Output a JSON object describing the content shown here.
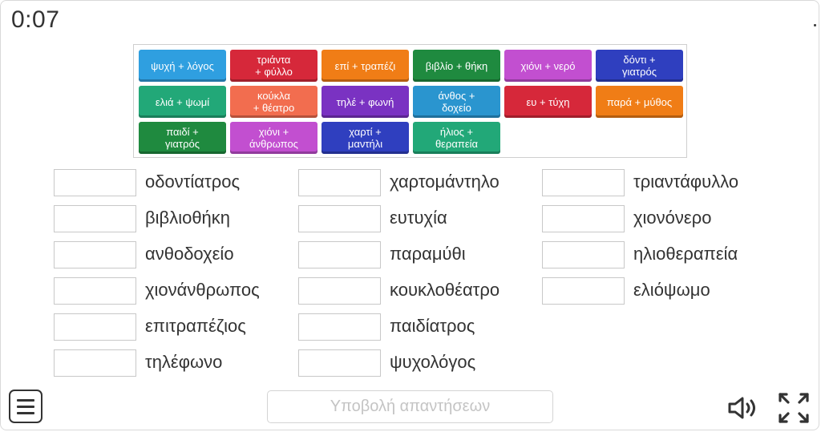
{
  "timer": "0:07",
  "tiles": [
    {
      "label": "ψυχή + λόγος",
      "color": "#2f9fe0"
    },
    {
      "label": "τριάντα\n+ φύλλο",
      "color": "#d6283a"
    },
    {
      "label": "επί + τραπέζι",
      "color": "#f07d16"
    },
    {
      "label": "βιβλίο + θήκη",
      "color": "#1f8a3f"
    },
    {
      "label": "χιόνι + νερό",
      "color": "#c24fd0"
    },
    {
      "label": "δόντι +\nγιατρός",
      "color": "#2f3fbf"
    },
    {
      "label": "ελιά + ψωμί",
      "color": "#22a878"
    },
    {
      "label": "κούκλα\n+ θέατρο",
      "color": "#f26d4f"
    },
    {
      "label": "τηλέ + φωνή",
      "color": "#7a32c2"
    },
    {
      "label": "άνθος +\nδοχείο",
      "color": "#2a95cf"
    },
    {
      "label": "ευ + τύχη",
      "color": "#d6283a"
    },
    {
      "label": "παρά + μύθος",
      "color": "#f07d16"
    },
    {
      "label": "παιδί +\nγιατρός",
      "color": "#1f8a3f"
    },
    {
      "label": "χιόνι +\nάνθρωπος",
      "color": "#c24fd0"
    },
    {
      "label": "χαρτί +\nμαντήλι",
      "color": "#2f3fbf"
    },
    {
      "label": "ήλιος +\nθεραπεία",
      "color": "#22a878"
    }
  ],
  "columns": [
    [
      "οδοντίατρος",
      "βιβλιοθήκη",
      "ανθοδοχείο",
      "χιονάνθρωπος",
      "επιτραπέζιος",
      "τηλέφωνο"
    ],
    [
      "χαρτομάντηλο",
      "ευτυχία",
      "παραμύθι",
      "κουκλοθέατρο",
      "παιδίατρος",
      "ψυχολόγος"
    ],
    [
      "τριαντάφυλλο",
      "χιονόνερο",
      "ηλιοθεραπεία",
      "ελιόψωμο"
    ]
  ],
  "submit_label": "Υποβολή απαντήσεων",
  "icons": {
    "menu": "menu-icon",
    "sound": "speaker-icon",
    "fullscreen": "fullscreen-icon"
  }
}
